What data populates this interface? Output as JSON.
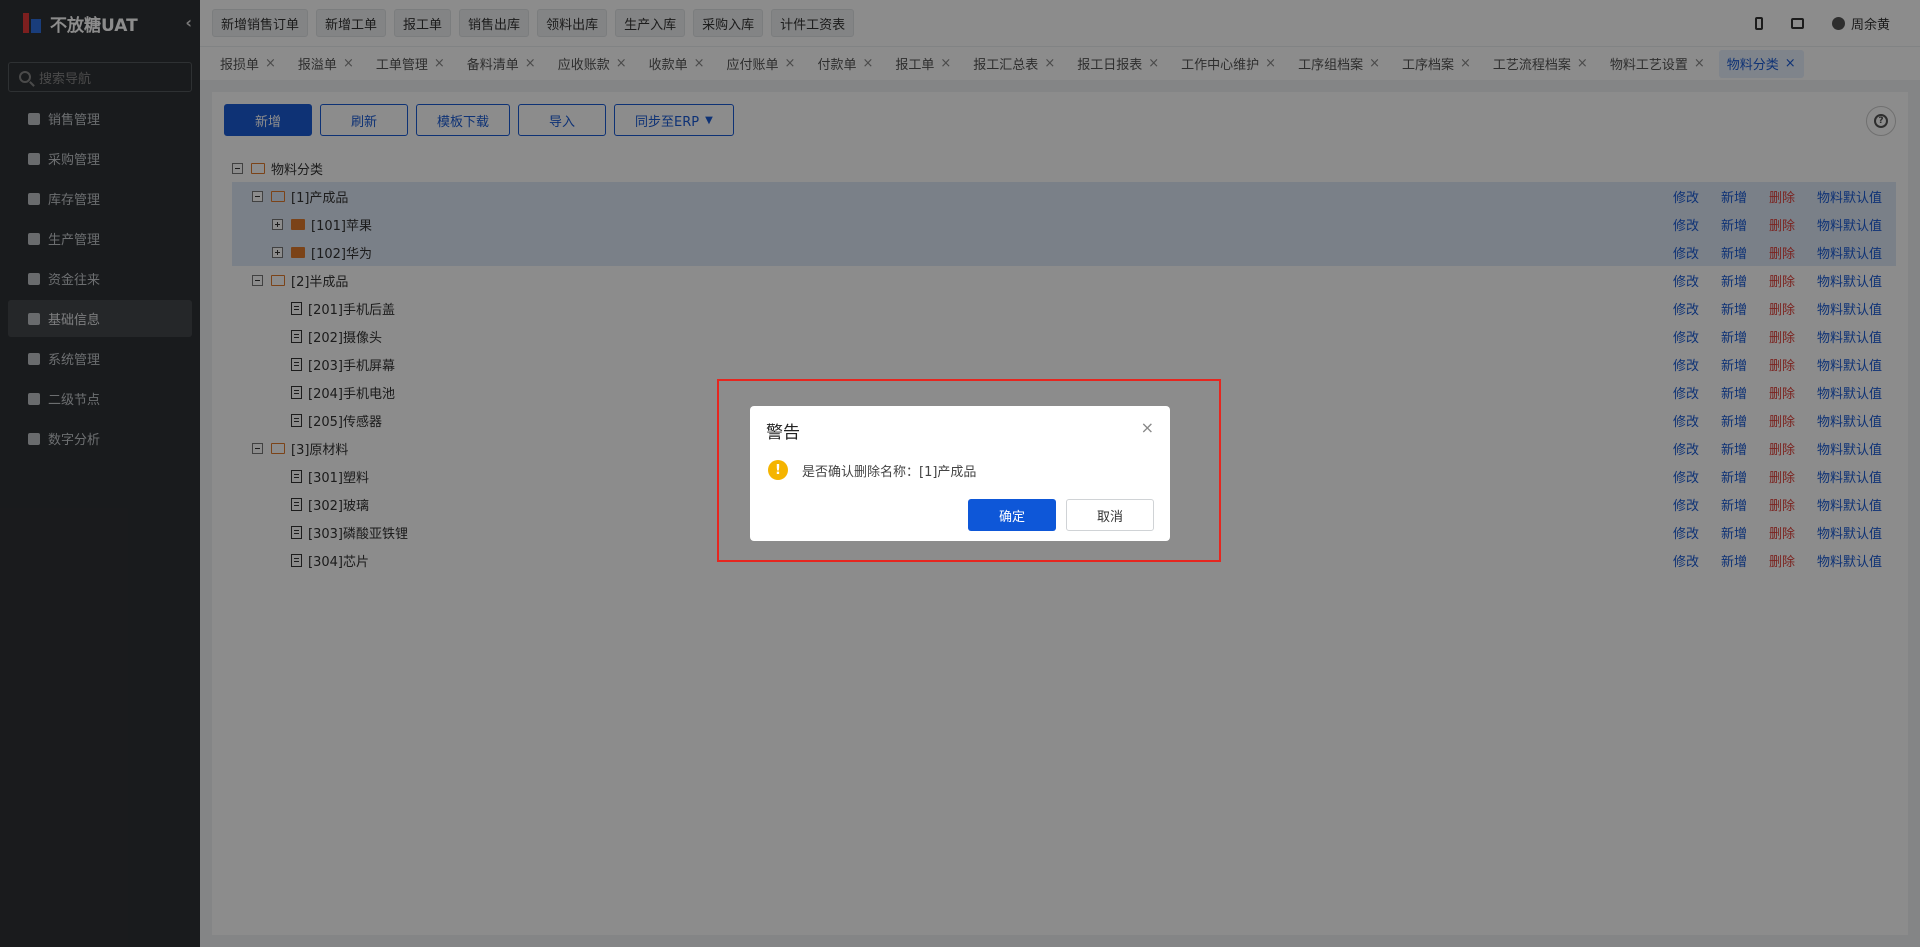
{
  "app": {
    "title": "不放糖UAT",
    "collapse": "‹"
  },
  "sidebar": {
    "search_placeholder": "搜索导航",
    "items": [
      {
        "label": "销售管理",
        "active": false
      },
      {
        "label": "采购管理",
        "active": false
      },
      {
        "label": "库存管理",
        "active": false
      },
      {
        "label": "生产管理",
        "active": false
      },
      {
        "label": "资金往来",
        "active": false
      },
      {
        "label": "基础信息",
        "active": true
      },
      {
        "label": "系统管理",
        "active": false
      },
      {
        "label": "二级节点",
        "active": false
      },
      {
        "label": "数字分析",
        "active": false
      }
    ]
  },
  "topbar": {
    "quick": [
      "新增销售订单",
      "新增工单",
      "报工单",
      "销售出库",
      "领料出库",
      "生产入库",
      "采购入库",
      "计件工资表"
    ],
    "user": "周余黄"
  },
  "tabs": [
    {
      "label": "报损单",
      "active": false
    },
    {
      "label": "报溢单",
      "active": false
    },
    {
      "label": "工单管理",
      "active": false
    },
    {
      "label": "备料清单",
      "active": false
    },
    {
      "label": "应收账款",
      "active": false
    },
    {
      "label": "收款单",
      "active": false
    },
    {
      "label": "应付账单",
      "active": false
    },
    {
      "label": "付款单",
      "active": false
    },
    {
      "label": "报工单",
      "active": false
    },
    {
      "label": "报工汇总表",
      "active": false
    },
    {
      "label": "报工日报表",
      "active": false
    },
    {
      "label": "工作中心维护",
      "active": false
    },
    {
      "label": "工序组档案",
      "active": false
    },
    {
      "label": "工序档案",
      "active": false
    },
    {
      "label": "工艺流程档案",
      "active": false
    },
    {
      "label": "物料工艺设置",
      "active": false
    },
    {
      "label": "物料分类",
      "active": true
    }
  ],
  "toolbar": {
    "add": "新增",
    "refresh": "刷新",
    "template": "模板下载",
    "import": "导入",
    "sync": "同步至ERP"
  },
  "actions": {
    "edit": "修改",
    "add": "新增",
    "delete": "删除",
    "default": "物料默认值"
  },
  "tree": [
    {
      "label": "物料分类",
      "level": 0,
      "toggle": "minus",
      "icon": "folder-open",
      "actions": false,
      "selected": false
    },
    {
      "label": "[1]产成品",
      "level": 1,
      "toggle": "minus",
      "icon": "folder-open",
      "actions": true,
      "selected": true
    },
    {
      "label": "[101]苹果",
      "level": 2,
      "toggle": "plus",
      "icon": "folder",
      "actions": true,
      "selected": true
    },
    {
      "label": "[102]华为",
      "level": 2,
      "toggle": "plus",
      "icon": "folder",
      "actions": true,
      "selected": true
    },
    {
      "label": "[2]半成品",
      "level": 1,
      "toggle": "minus",
      "icon": "folder-open",
      "actions": true,
      "selected": false
    },
    {
      "label": "[201]手机后盖",
      "level": 2,
      "toggle": "none",
      "icon": "doc",
      "actions": true,
      "selected": false
    },
    {
      "label": "[202]摄像头",
      "level": 2,
      "toggle": "none",
      "icon": "doc",
      "actions": true,
      "selected": false
    },
    {
      "label": "[203]手机屏幕",
      "level": 2,
      "toggle": "none",
      "icon": "doc",
      "actions": true,
      "selected": false
    },
    {
      "label": "[204]手机电池",
      "level": 2,
      "toggle": "none",
      "icon": "doc",
      "actions": true,
      "selected": false
    },
    {
      "label": "[205]传感器",
      "level": 2,
      "toggle": "none",
      "icon": "doc",
      "actions": true,
      "selected": false
    },
    {
      "label": "[3]原材料",
      "level": 1,
      "toggle": "minus",
      "icon": "folder-open",
      "actions": true,
      "selected": false
    },
    {
      "label": "[301]塑料",
      "level": 2,
      "toggle": "none",
      "icon": "doc",
      "actions": true,
      "selected": false
    },
    {
      "label": "[302]玻璃",
      "level": 2,
      "toggle": "none",
      "icon": "doc",
      "actions": true,
      "selected": false
    },
    {
      "label": "[303]磷酸亚铁锂",
      "level": 2,
      "toggle": "none",
      "icon": "doc",
      "actions": true,
      "selected": false
    },
    {
      "label": "[304]芯片",
      "level": 2,
      "toggle": "none",
      "icon": "doc",
      "actions": true,
      "selected": false
    }
  ],
  "dialog": {
    "title": "警告",
    "close": "×",
    "message": "是否确认删除名称：[1]产成品",
    "warn_glyph": "!",
    "confirm": "确定",
    "cancel": "取消"
  },
  "colors": {
    "primary": "#1a5bd6",
    "danger": "#e0403a",
    "warn": "#f5b400",
    "sidebar": "#2f3235"
  }
}
